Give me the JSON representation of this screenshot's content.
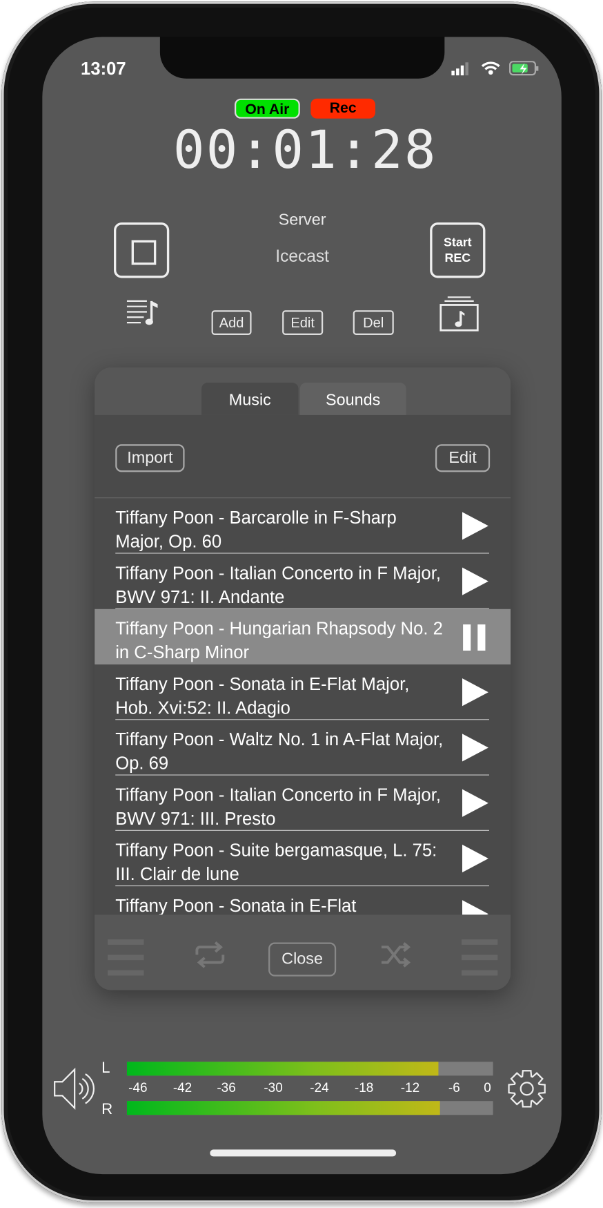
{
  "status_bar": {
    "time": "13:07"
  },
  "badges": {
    "on_air": "On Air",
    "rec": "Rec",
    "on_air_color": "#00e000",
    "rec_color": "#ff2a00"
  },
  "timer": "00:01:28",
  "server": {
    "label": "Server",
    "value": "Icecast"
  },
  "controls": {
    "start_rec": [
      "Start",
      "REC"
    ],
    "add": "Add",
    "edit": "Edit",
    "del": "Del"
  },
  "panel": {
    "tabs": [
      {
        "label": "Music",
        "active": true
      },
      {
        "label": "Sounds",
        "active": false
      }
    ],
    "import": "Import",
    "edit": "Edit",
    "close": "Close",
    "tracks": [
      {
        "title": "Tiffany Poon - Barcarolle in F-Sharp Major, Op. 60",
        "state": "play"
      },
      {
        "title": "Tiffany Poon - Italian Concerto in F Major, BWV 971: II. Andante",
        "state": "play"
      },
      {
        "title": "Tiffany Poon - Hungarian Rhapsody No. 2 in C-Sharp Minor",
        "state": "pause"
      },
      {
        "title": "Tiffany Poon - Sonata in E-Flat Major, Hob. Xvi:52: II. Adagio",
        "state": "play"
      },
      {
        "title": "Tiffany Poon - Waltz No. 1 in A-Flat Major, Op. 69",
        "state": "play"
      },
      {
        "title": "Tiffany Poon - Italian Concerto in F Major, BWV 971: III. Presto",
        "state": "play"
      },
      {
        "title": "Tiffany Poon - Suite bergamasque, L. 75: III. Clair de lune",
        "state": "play"
      },
      {
        "title": "Tiffany Poon - Sonata in E-Flat",
        "state": "play"
      }
    ]
  },
  "meter": {
    "left_label": "L",
    "right_label": "R",
    "scale": [
      "-46",
      "-42",
      "-36",
      "-30",
      "-24",
      "-18",
      "-12",
      "-6",
      "0"
    ],
    "left_level": 0.85,
    "right_level": 0.855
  }
}
